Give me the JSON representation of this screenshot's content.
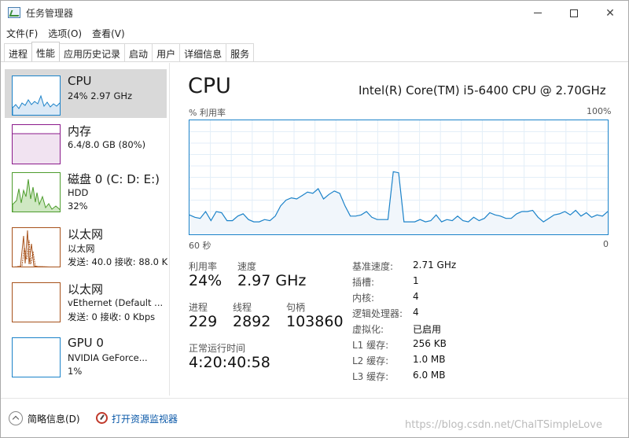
{
  "window": {
    "title": "任务管理器"
  },
  "menu": [
    "文件(F)",
    "选项(O)",
    "查看(V)"
  ],
  "tabs": [
    "进程",
    "性能",
    "应用历史记录",
    "启动",
    "用户",
    "详细信息",
    "服务"
  ],
  "active_tab": "性能",
  "sidebar": {
    "items": [
      {
        "title": "CPU",
        "line1": "24% 2.97 GHz",
        "line2": "",
        "color": "#1b82c9"
      },
      {
        "title": "内存",
        "line1": "6.4/8.0 GB (80%)",
        "line2": "",
        "color": "#8b1a8b"
      },
      {
        "title": "磁盘 0 (C: D: E:)",
        "line1": "HDD",
        "line2": "32%",
        "color": "#4d9c2d"
      },
      {
        "title": "以太网",
        "line1": "以太网",
        "line2": "发送: 40.0 接收: 88.0 K",
        "color": "#a7521b"
      },
      {
        "title": "以太网",
        "line1": "vEthernet (Default ...",
        "line2": "发送: 0 接收: 0 Kbps",
        "color": "#a7521b"
      },
      {
        "title": "GPU 0",
        "line1": "NVIDIA GeForce...",
        "line2": "1%",
        "color": "#1b82c9"
      }
    ]
  },
  "main": {
    "title": "CPU",
    "model": "Intel(R) Core(TM) i5-6400 CPU @ 2.70GHz",
    "util_label": "% 利用率",
    "util_max": "100%",
    "axis_left": "60 秒",
    "axis_right": "0",
    "stats": {
      "util_label": "利用率",
      "util_value": "24%",
      "speed_label": "速度",
      "speed_value": "2.97 GHz",
      "proc_label": "进程",
      "proc_value": "229",
      "threads_label": "线程",
      "threads_value": "2892",
      "handles_label": "句柄",
      "handles_value": "103860",
      "uptime_label": "正常运行时间",
      "uptime_value": "4:20:40:58"
    },
    "details": [
      {
        "key": "基准速度:",
        "value": "2.71 GHz"
      },
      {
        "key": "插槽:",
        "value": "1"
      },
      {
        "key": "内核:",
        "value": "4"
      },
      {
        "key": "逻辑处理器:",
        "value": "4"
      },
      {
        "key": "虚拟化:",
        "value": "已启用"
      },
      {
        "key": "L1 缓存:",
        "value": "256 KB"
      },
      {
        "key": "L2 缓存:",
        "value": "1.0 MB"
      },
      {
        "key": "L3 缓存:",
        "value": "6.0 MB"
      }
    ],
    "cpu_history": [
      17,
      15,
      14,
      20,
      12,
      20,
      19,
      12,
      12,
      16,
      18,
      13,
      11,
      11,
      13,
      12,
      16,
      25,
      30,
      32,
      31,
      34,
      37,
      36,
      40,
      31,
      35,
      38,
      36,
      25,
      16,
      16,
      17,
      20,
      15,
      13,
      13,
      13,
      55,
      54,
      11,
      11,
      11,
      13,
      11,
      12,
      17,
      11,
      13,
      12,
      16,
      12,
      11,
      15,
      12,
      14,
      19,
      17,
      16,
      14,
      14,
      18,
      20,
      20,
      21,
      15,
      11,
      14,
      17,
      18,
      20,
      17,
      21,
      16,
      19,
      15,
      17,
      16,
      20
    ]
  },
  "bottom": {
    "brief_label": "简略信息(D)",
    "monitor_label": "打开资源监视器",
    "watermark": "https://blog.csdn.net/ChalTSimpleLove"
  },
  "colors": {
    "cpu": "#1b82c9",
    "memory": "#8b1a8b",
    "disk": "#4d9c2d",
    "ethernet": "#a7521b",
    "gpu": "#1b82c9",
    "selected": "#d9d9d9"
  }
}
